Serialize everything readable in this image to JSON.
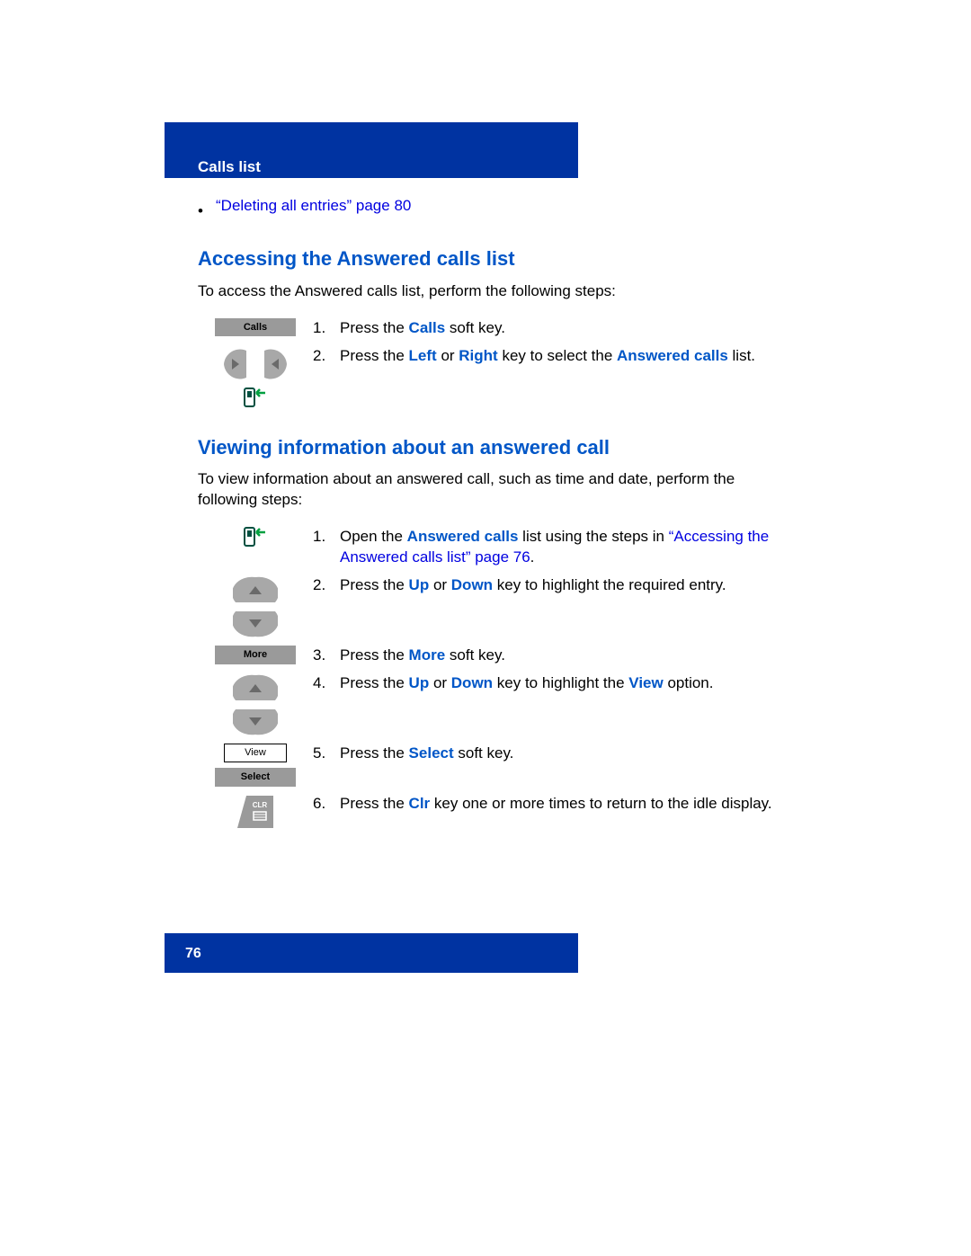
{
  "header": {
    "section_label": "Calls list"
  },
  "bullet_xref": "“Deleting all entries” page 80",
  "section1": {
    "heading": "Accessing the Answered calls list",
    "intro": "To access the Answered calls list, perform the following steps:",
    "calls_chip": "Calls",
    "step1_num": "1.",
    "step1_a": "Press the ",
    "step1_kw": "Calls",
    "step1_b": " soft key.",
    "step2_num": "2.",
    "step2_a": "Press the ",
    "step2_kw1": "Left",
    "step2_b": " or ",
    "step2_kw2": "Right",
    "step2_c": " key to select the ",
    "step2_kw3": "Answered calls",
    "step2_d": " list."
  },
  "section2": {
    "heading": "Viewing information about an answered call",
    "intro": "To view information about an answered call, such as time and date, perform the following steps:",
    "step1_num": "1.",
    "step1_a": "Open the ",
    "step1_kw": "Answered calls",
    "step1_b": " list using the steps in ",
    "step1_xref": "“Accessing the Answered calls list” page 76",
    "step1_c": ".",
    "step2_num": "2.",
    "step2_a": "Press the ",
    "step2_kw1": "Up",
    "step2_b": " or ",
    "step2_kw2": "Down",
    "step2_c": " key to highlight the required entry.",
    "more_chip": "More",
    "step3_num": "3.",
    "step3_a": "Press the ",
    "step3_kw": "More",
    "step3_b": " soft key.",
    "step4_num": "4.",
    "step4_a": "Press the ",
    "step4_kw1": "Up",
    "step4_b": " or ",
    "step4_kw2": "Down",
    "step4_c": " key to highlight the ",
    "step4_kw3": "View",
    "step4_d": " option.",
    "view_chip": "View",
    "select_chip": "Select",
    "step5_num": "5.",
    "step5_a": "Press the ",
    "step5_kw": "Select",
    "step5_b": " soft key.",
    "step6_num": "6.",
    "step6_a": "Press the ",
    "step6_kw": "Clr",
    "step6_b": " key one or more times to return to the idle display."
  },
  "page_number": "76"
}
